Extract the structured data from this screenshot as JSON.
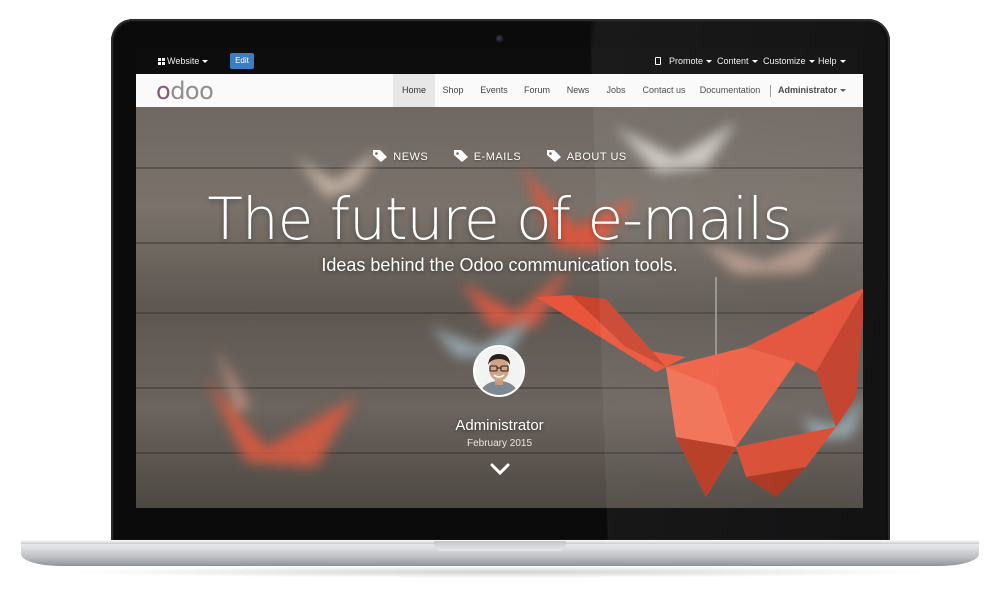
{
  "admin_bar": {
    "website_label": "Website",
    "edit_label": "Edit",
    "promote_label": "Promote",
    "content_label": "Content",
    "customize_label": "Customize",
    "help_label": "Help"
  },
  "navbar": {
    "logo_first": "o",
    "logo_rest": "doo",
    "items": [
      {
        "label": "Home"
      },
      {
        "label": "Shop"
      },
      {
        "label": "Events"
      },
      {
        "label": "Forum"
      },
      {
        "label": "News"
      },
      {
        "label": "Jobs"
      },
      {
        "label": "Contact us"
      },
      {
        "label": "Documentation"
      }
    ],
    "user_label": "Administrator"
  },
  "hero": {
    "categories": [
      {
        "label": "NEWS"
      },
      {
        "label": "E-MAILS"
      },
      {
        "label": "ABOUT US"
      }
    ],
    "title": "The future of e-mails",
    "subtitle": "Ideas behind the Odoo communication tools.",
    "author": "Administrator",
    "date": "February 2015"
  },
  "colors": {
    "brand_purple": "#875a7b",
    "edit_blue": "#3a7dc0",
    "crane_orange": "#e8553a"
  }
}
